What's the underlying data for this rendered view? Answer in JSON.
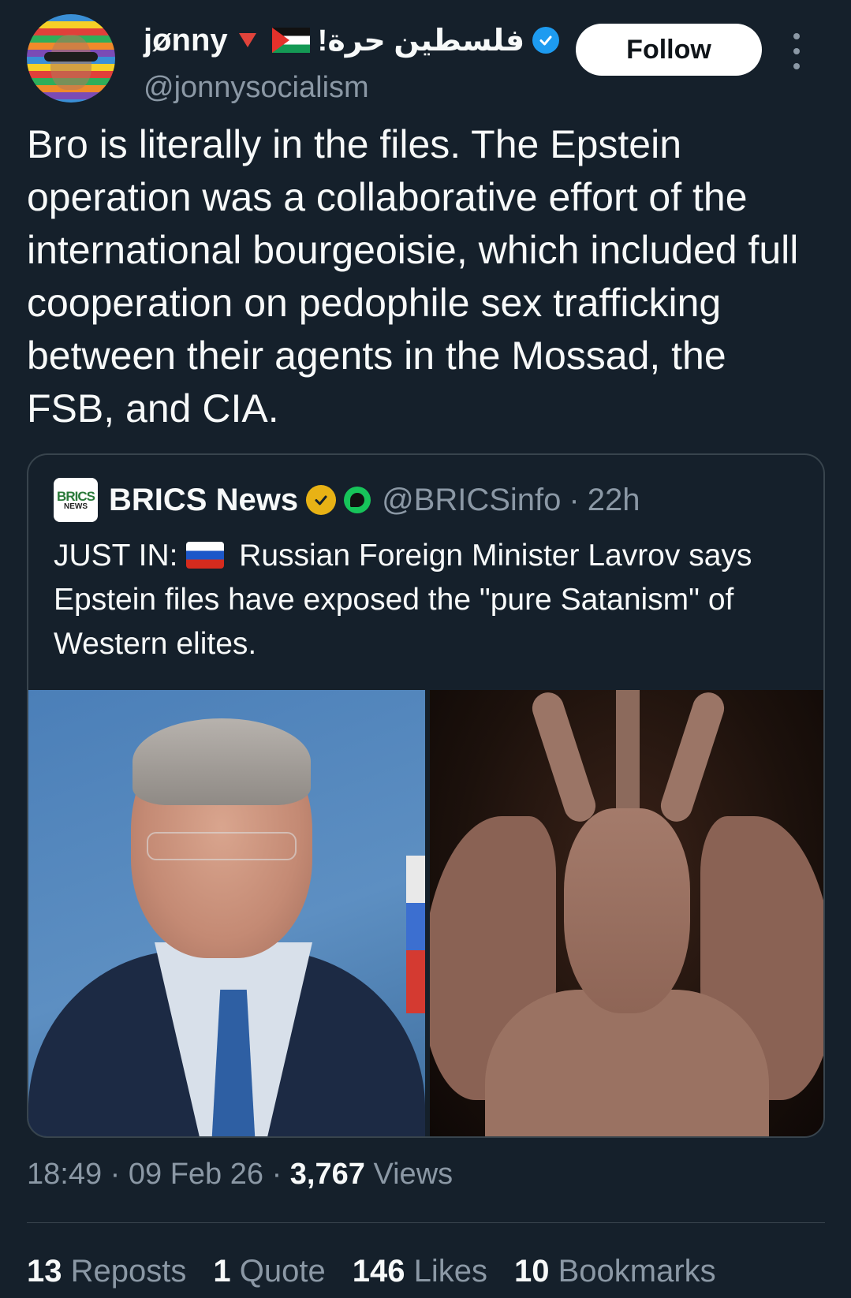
{
  "author": {
    "display_name": "jønny",
    "rtl_text": "فلسطين حرة!",
    "handle": "@jonnysocialism",
    "follow_label": "Follow"
  },
  "tweet": {
    "text": "Bro is literally in the files. The Epstein operation was a collaborative effort of the international bourgeoisie, which included full cooperation on pedophile sex trafficking between their agents in the Mossad, the FSB, and CIA."
  },
  "quote": {
    "logo_line1": "BRICS",
    "logo_line2": "NEWS",
    "name": "BRICS News",
    "handle": "@BRICSinfo",
    "separator": "·",
    "time": "22h",
    "prefix": "JUST IN:",
    "text": "Russian Foreign Minister Lavrov says Epstein files have exposed the \"pure Satanism\" of Western elites."
  },
  "meta": {
    "time": "18:49",
    "sep1": "·",
    "date": "09 Feb 26",
    "sep2": "·",
    "views_count": "3,767",
    "views_label": "Views"
  },
  "stats": {
    "reposts_count": "13",
    "reposts_label": "Reposts",
    "quotes_count": "1",
    "quotes_label": "Quote",
    "likes_count": "146",
    "likes_label": "Likes",
    "bookmarks_count": "10",
    "bookmarks_label": "Bookmarks"
  },
  "colors": {
    "background": "#15202b",
    "text": "#f7f9f9",
    "secondary": "#8b98a5",
    "verified_blue": "#1d9bf0",
    "verified_gold": "#e8b215"
  },
  "icons": [
    "red-triangle-icon",
    "palestine-flag-icon",
    "verified-badge-icon",
    "more-options-icon",
    "gold-verified-badge-icon",
    "green-badge-icon",
    "russia-flag-icon"
  ]
}
